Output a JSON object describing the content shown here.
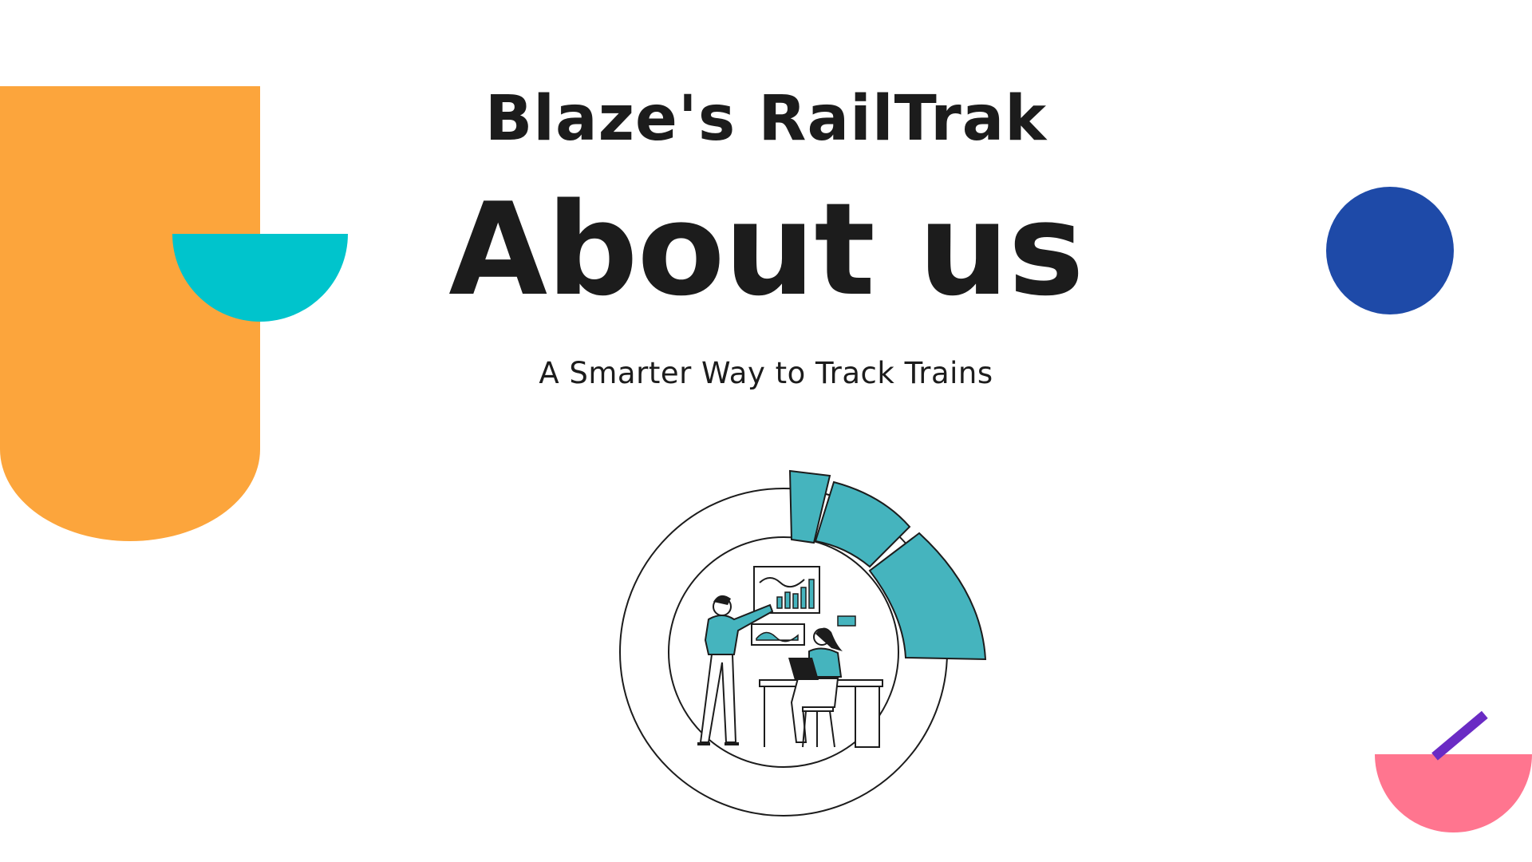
{
  "header": {
    "brand": "Blaze's RailTrak",
    "title": "About us",
    "tagline": "A Smarter Way to Track Trains"
  },
  "colors": {
    "background": "#ffffff",
    "text": "#1c1c1c",
    "orange": "#fca53c",
    "teal": "#00c4cc",
    "illustration_teal": "#45b4be",
    "blue": "#1e4aa8",
    "pink": "#ff758f",
    "purple": "#6a2bc4"
  },
  "illustration": {
    "icon": "team-analytics-illustration"
  }
}
